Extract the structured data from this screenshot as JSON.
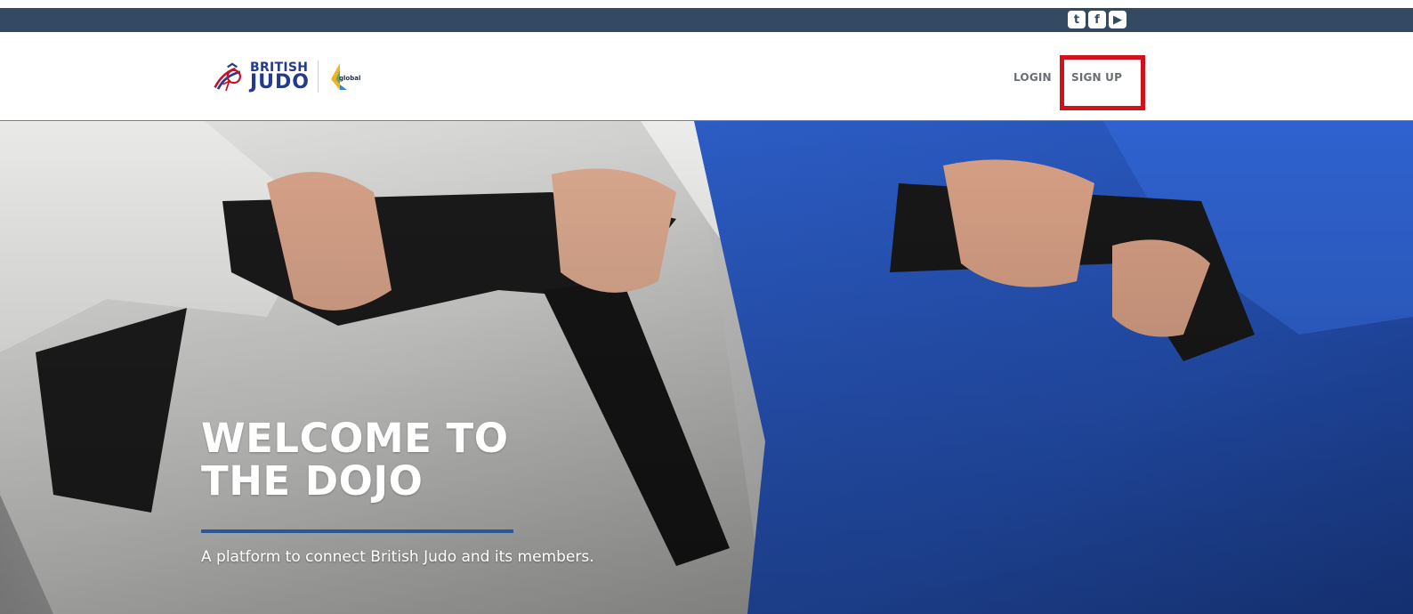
{
  "social": {
    "icons": [
      {
        "name": "twitter-icon",
        "glyph": "t"
      },
      {
        "name": "facebook-icon",
        "glyph": "f"
      },
      {
        "name": "youtube-icon",
        "glyph": "▶"
      }
    ]
  },
  "header": {
    "logo_line1": "BRITISH",
    "logo_line2": "JUDO",
    "partner_logo_text": "global",
    "nav": {
      "login_label": "LOGIN",
      "signup_label": "SIGN UP"
    }
  },
  "hero": {
    "title_line1": "WELCOME TO",
    "title_line2": "THE DOJO",
    "subtitle": "A platform to connect British Judo and its members."
  },
  "colors": {
    "topbar": "#344a63",
    "highlight": "#d0121a",
    "rule": "#2b5797",
    "brand": "#243a8a"
  }
}
